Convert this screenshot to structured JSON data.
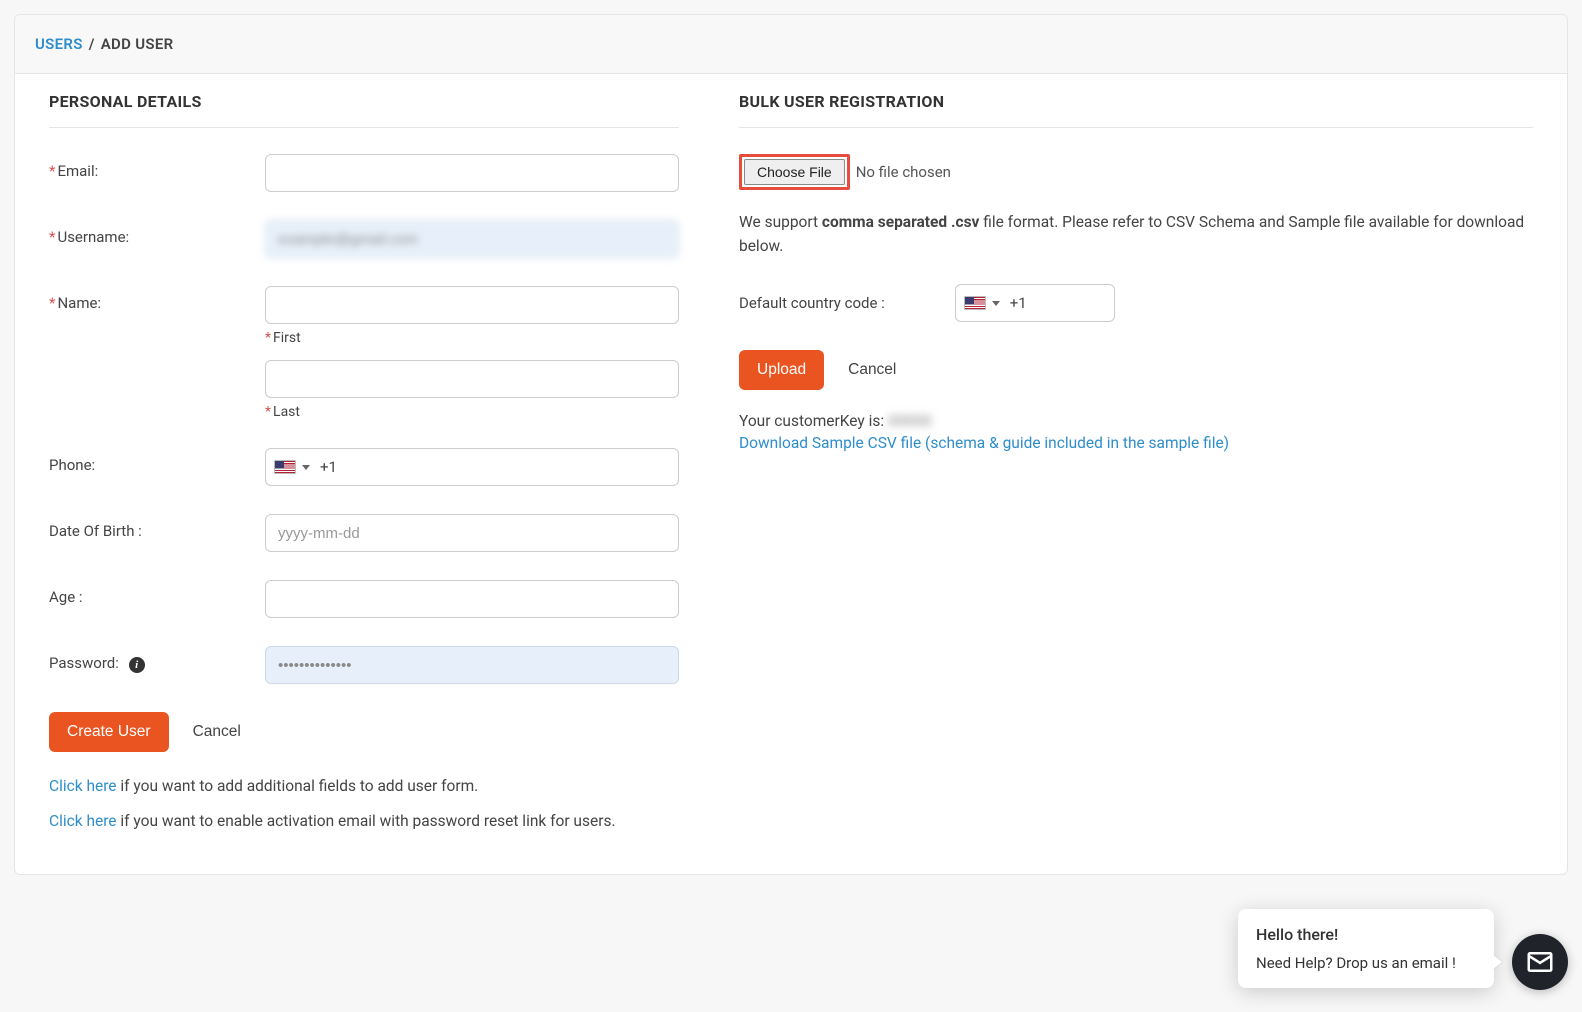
{
  "breadcrumb": {
    "parent": "USERS",
    "sep": "/",
    "current": "ADD USER"
  },
  "left": {
    "title": "PERSONAL DETAILS",
    "email_label": "Email:",
    "username_label": "Username:",
    "username_value": "example@gmail.com",
    "name_label": "Name:",
    "first_label": "First",
    "last_label": "Last",
    "phone_label": "Phone:",
    "phone_code": "+1",
    "dob_label": "Date Of Birth :",
    "dob_placeholder": "yyyy-mm-dd",
    "age_label": "Age :",
    "password_label": "Password:",
    "password_value": "••••••••••••••",
    "create_btn": "Create User",
    "cancel_btn": "Cancel",
    "hint1_link": "Click here",
    "hint1_text": " if you want to add additional fields to add user form.",
    "hint2_link": "Click here",
    "hint2_text": " if you want to enable activation email with password reset link for users."
  },
  "right": {
    "title": "BULK USER REGISTRATION",
    "choose_file_btn": "Choose File",
    "no_file": "No file chosen",
    "support_pre": "We support ",
    "support_bold": "comma separated .csv",
    "support_post": " file format. Please refer to CSV Schema and Sample file available for download below.",
    "cc_label": "Default country code :",
    "cc_code": "+1",
    "upload_btn": "Upload",
    "cancel_btn": "Cancel",
    "ck_label": "Your customerKey is: ",
    "ck_value": "00000",
    "download_link": "Download Sample CSV file (schema & guide included in the sample file)"
  },
  "chat": {
    "hi": "Hello there!",
    "msg": "Need Help? Drop us an email !"
  }
}
